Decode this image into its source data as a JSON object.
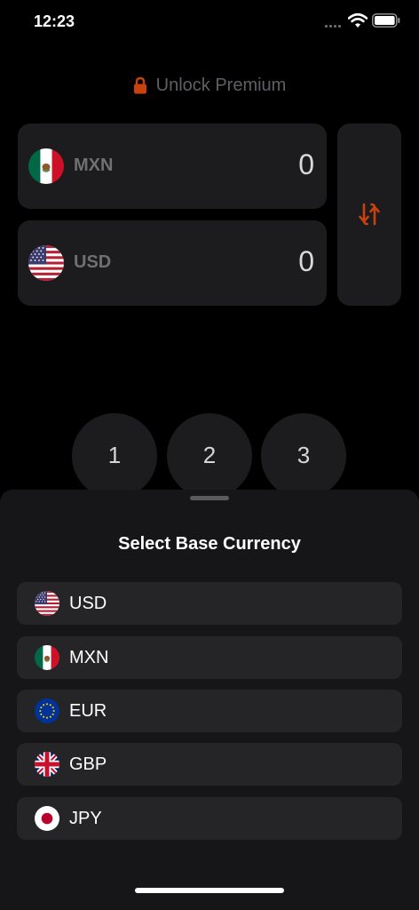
{
  "status": {
    "time": "12:23"
  },
  "premium": {
    "label": "Unlock Premium"
  },
  "converter": {
    "from": {
      "code": "MXN",
      "value": "0"
    },
    "to": {
      "code": "USD",
      "value": "0"
    }
  },
  "keypad": {
    "keys": [
      "1",
      "2",
      "3"
    ]
  },
  "sheet": {
    "title": "Select Base Currency",
    "options": [
      {
        "code": "USD"
      },
      {
        "code": "MXN"
      },
      {
        "code": "EUR"
      },
      {
        "code": "GBP"
      },
      {
        "code": "JPY"
      }
    ]
  },
  "colors": {
    "accent": "#c8420f",
    "card": "#1c1c1e",
    "sheet": "#161618",
    "option": "#252527"
  },
  "icons": {
    "lock": "lock-icon",
    "swap": "swap-arrows-icon",
    "wifi": "wifi-icon",
    "battery": "battery-icon"
  }
}
